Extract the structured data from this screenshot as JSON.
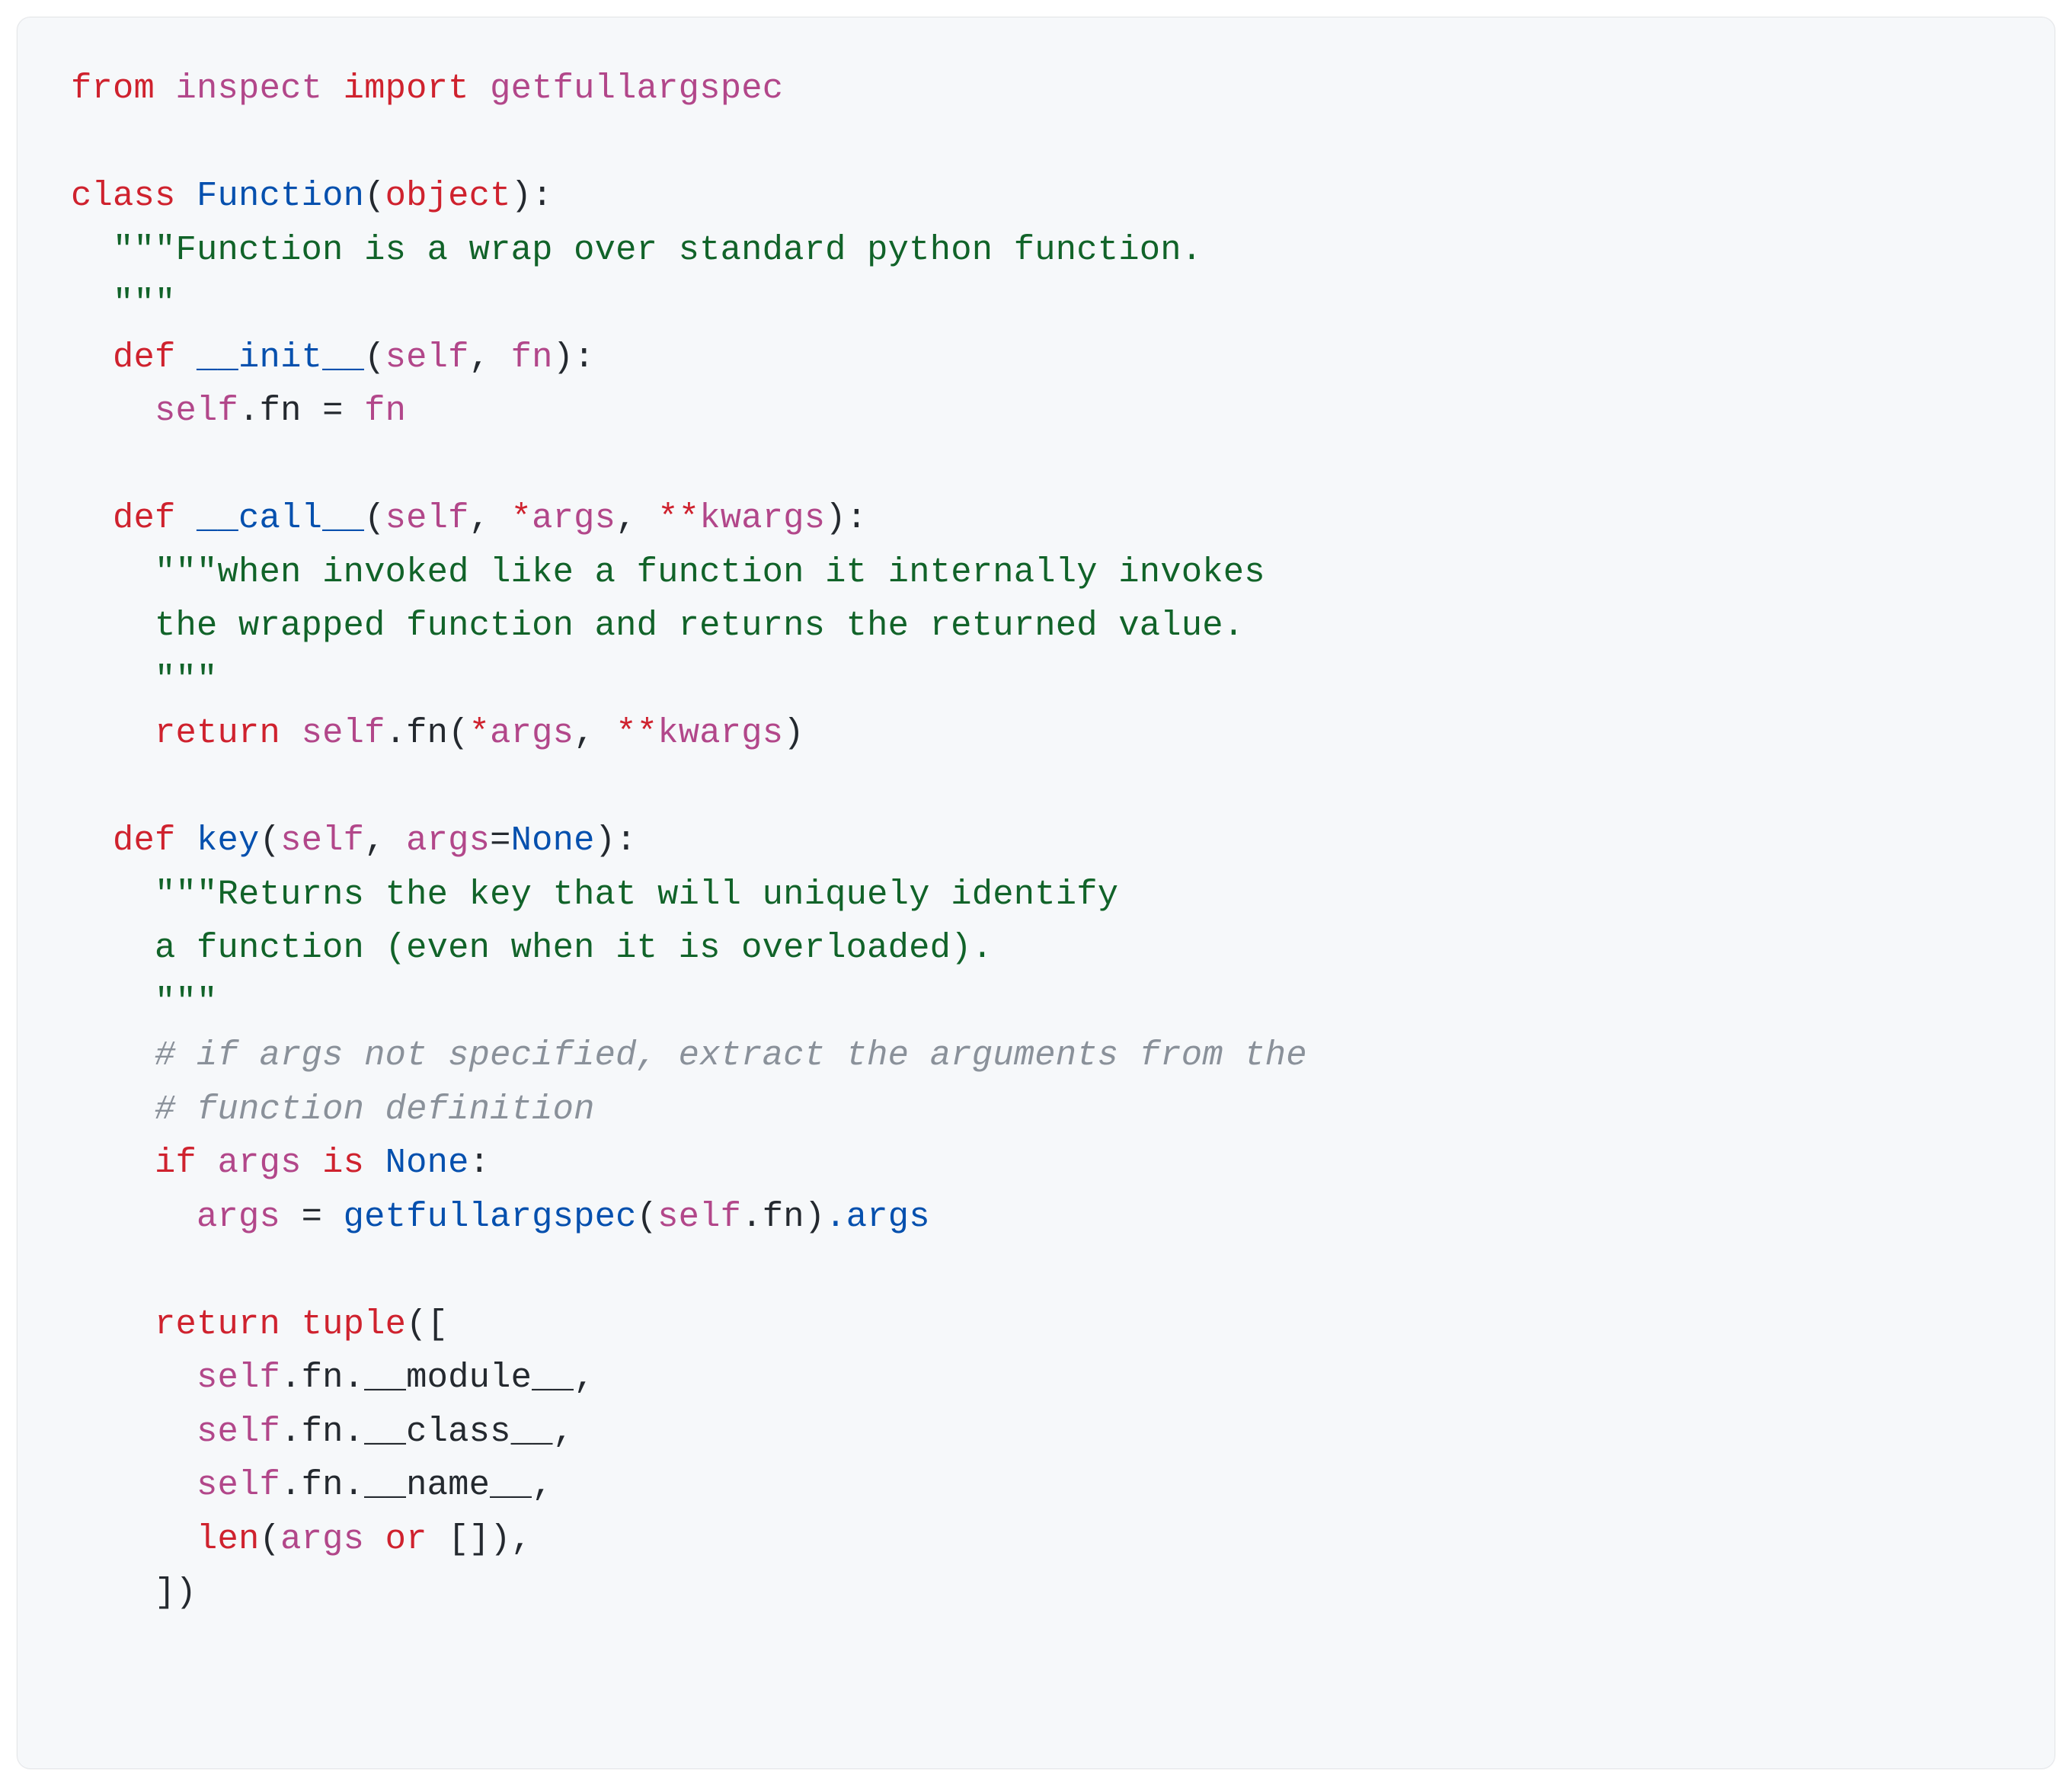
{
  "language": "python",
  "code": {
    "l01_from": "from",
    "l01_inspect": "inspect",
    "l01_import": "import",
    "l01_getfullargspec": "getfullargspec",
    "l03_class": "class",
    "l03_name": "Function",
    "l03_base": "object",
    "l04_doc": "\"\"\"Function is a wrap over standard python function.",
    "l05_doc": "  \"\"\"",
    "l06_def": "def",
    "l06_name": "__init__",
    "l06_self": "self",
    "l06_fn": "fn",
    "l07_selffn": "self",
    "l07_dotfn": ".fn = ",
    "l07_fn": "fn",
    "l09_def": "def",
    "l09_name": "__call__",
    "l09_self": "self",
    "l09_args": "args",
    "l09_kwargs": "kwargs",
    "l10_doc": "\"\"\"when invoked like a function it internally invokes",
    "l11_doc": "    the wrapped function and returns the returned value.",
    "l12_doc": "    \"\"\"",
    "l13_return": "return",
    "l13_self": "self",
    "l13_dotfn": ".fn(",
    "l13_args": "args",
    "l13_kwargs": "kwargs",
    "l15_def": "def",
    "l15_name": "key",
    "l15_self": "self",
    "l15_args": "args",
    "l15_none": "None",
    "l16_doc": "\"\"\"Returns the key that will uniquely identify",
    "l17_doc": "    a function (even when it is overloaded).",
    "l18_doc": "    \"\"\"",
    "l19_cmt": "# if args not specified, extract the arguments from the",
    "l20_cmt": "# function definition",
    "l21_if": "if",
    "l21_args": "args",
    "l21_is": "is",
    "l21_none": "None",
    "l22_args": "args",
    "l22_eq": " = ",
    "l22_getfullargspec": "getfullargspec",
    "l22_self": "self",
    "l22_dotfn": ".fn",
    "l22_dotargs": ".args",
    "l24_return": "return",
    "l24_tuple": "tuple",
    "l25_self": "self",
    "l25_dotfn": ".fn.__module__,",
    "l26_self": "self",
    "l26_dotfn": ".fn.__class__,",
    "l27_self": "self",
    "l27_dotfn": ".fn.__name__,",
    "l28_len": "len",
    "l28_args": "args",
    "l28_or": "or"
  }
}
